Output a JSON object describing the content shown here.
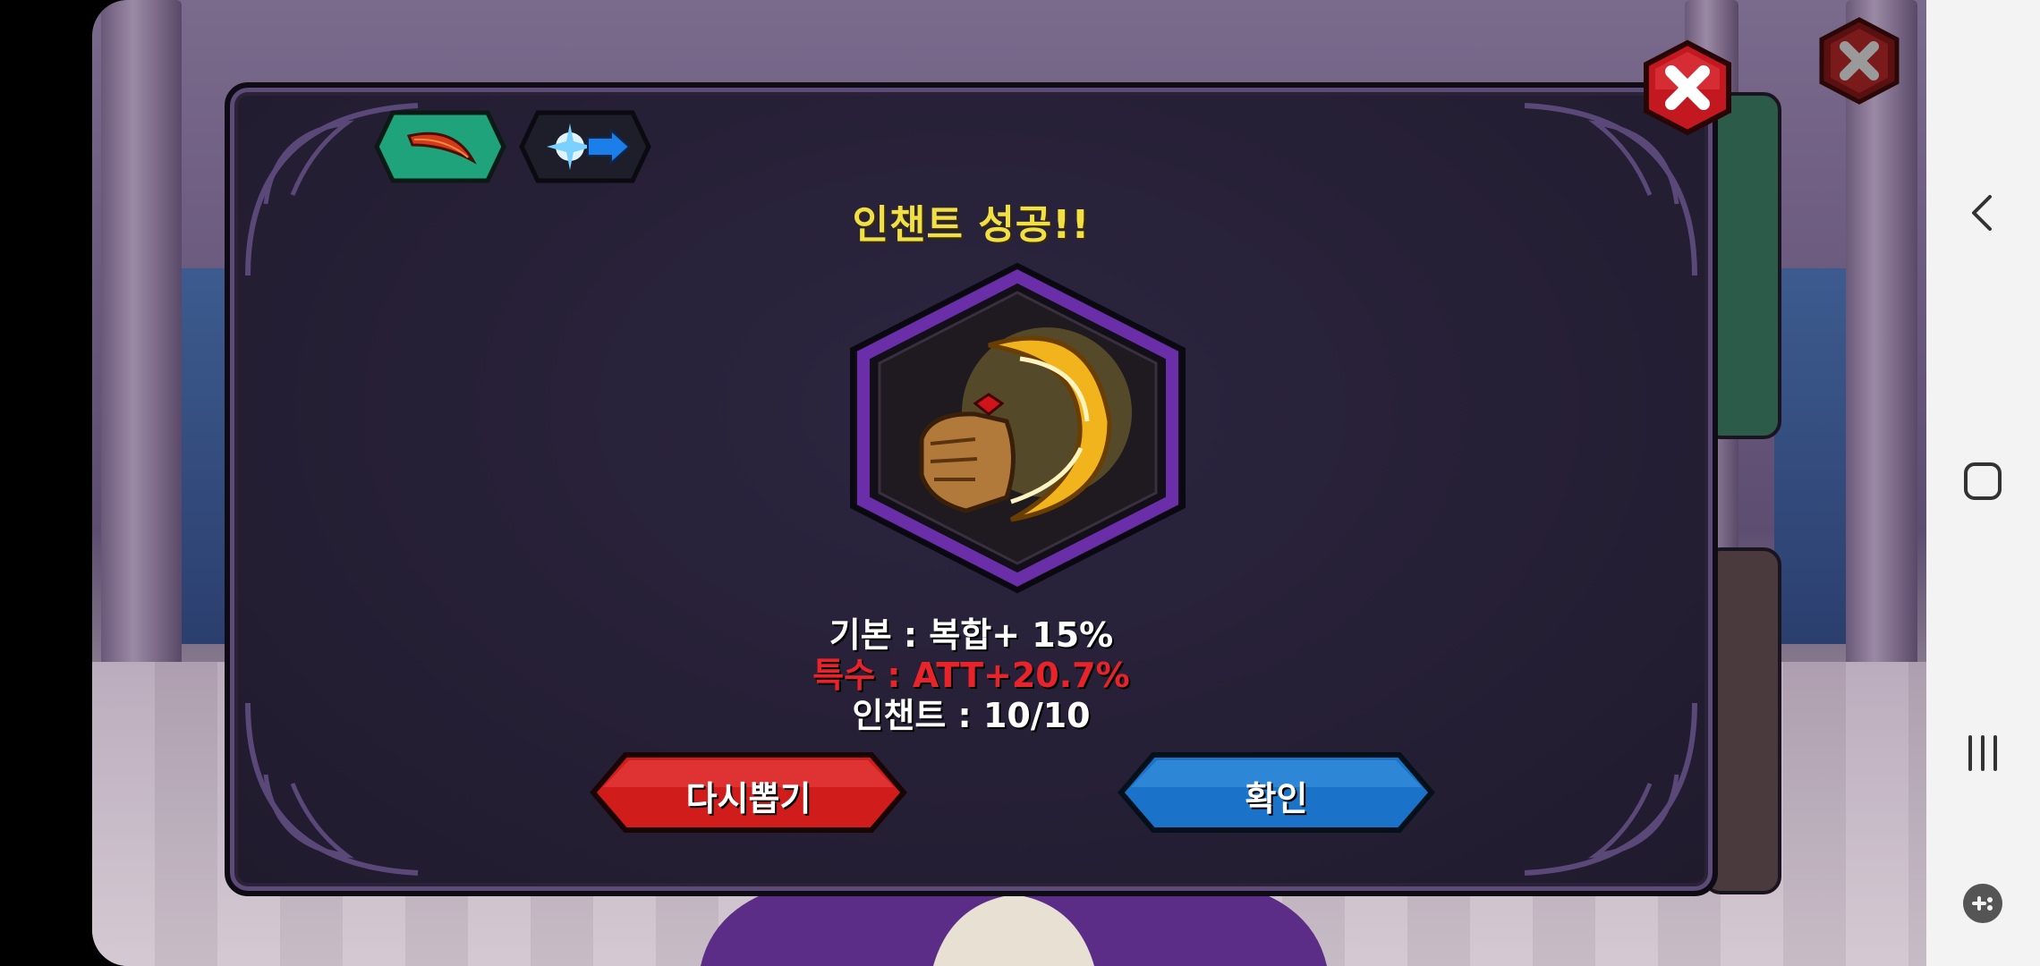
{
  "dialog": {
    "title": "인챈트 성공!!",
    "stats": {
      "base": "기본 : 복합+ 15%",
      "special": "특수 : ATT+20.7%",
      "enchant": "인챈트 : 10/10"
    },
    "buttons": {
      "retry": "다시뽑기",
      "confirm": "확인"
    },
    "tabs": [
      {
        "icon": "red-feather-icon",
        "color": "#1fa37a"
      },
      {
        "icon": "blue-burst-arrow-icon",
        "color": "#1e1e2a"
      }
    ],
    "item_icon": "golden-crescent-gauntlet-icon"
  },
  "colors": {
    "title": "#f0e046",
    "special_stat": "#e8242a",
    "retry_button": "#d11c1c",
    "confirm_button": "#1a73c8",
    "frame": "#6a2fa8"
  },
  "navbar": {
    "icons": [
      "back-icon",
      "home-icon",
      "recents-icon",
      "game-tools-icon"
    ]
  }
}
